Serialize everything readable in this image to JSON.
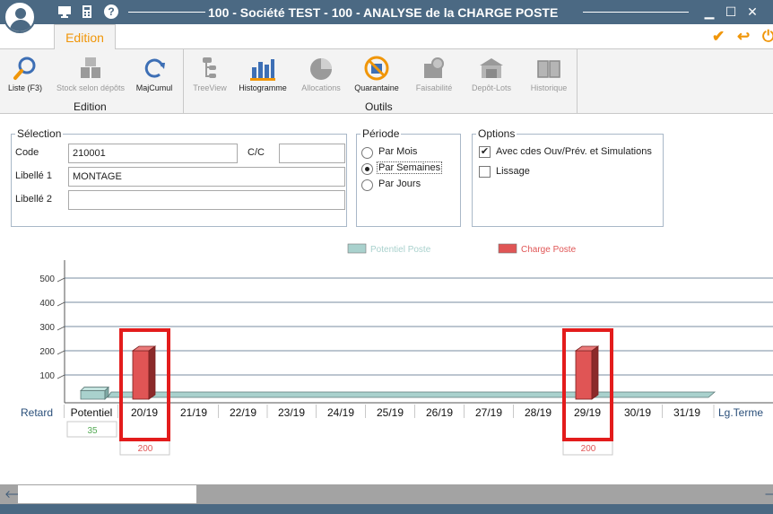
{
  "window": {
    "title": "100 - Société TEST - 100 - ANALYSE de la CHARGE POSTE",
    "help_label": "?",
    "minimize_glyph": "▁",
    "maximize_glyph": "☐",
    "close_glyph": "✕"
  },
  "ribbon": {
    "tab_label": "Edition",
    "actions": {
      "validate_glyph": "✔",
      "back_glyph": "↩",
      "power_glyph": "⏻"
    },
    "edition_group": {
      "label": "Edition",
      "buttons": [
        {
          "label": "Liste (F3)",
          "icon": "search-icon",
          "enabled": true
        },
        {
          "label": "Stock selon dépôts",
          "icon": "boxes-icon",
          "enabled": false
        },
        {
          "label": "MajCumul",
          "icon": "refresh-icon",
          "enabled": true
        }
      ]
    },
    "outils_group": {
      "label": "Outils",
      "buttons": [
        {
          "label": "TreeView",
          "icon": "treeview-icon",
          "enabled": false
        },
        {
          "label": "Histogramme",
          "icon": "histogram-icon",
          "enabled": true
        },
        {
          "label": "Allocations",
          "icon": "pie-chart-icon",
          "enabled": false
        },
        {
          "label": "Quarantaine",
          "icon": "quarantine-icon",
          "enabled": true
        },
        {
          "label": "Faisabilité",
          "icon": "feasibility-icon",
          "enabled": false
        },
        {
          "label": "Depôt-Lots",
          "icon": "warehouse-icon",
          "enabled": false
        },
        {
          "label": "Historique",
          "icon": "book-icon",
          "enabled": false
        }
      ]
    }
  },
  "selection": {
    "legend": "Sélection",
    "code_label": "Code",
    "code_value": "210001",
    "cc_label": "C/C",
    "cc_value": "",
    "libelle1_label": "Libellé 1",
    "libelle1_value": "MONTAGE",
    "libelle2_label": "Libellé 2",
    "libelle2_value": ""
  },
  "periode": {
    "legend": "Période",
    "options": [
      "Par Mois",
      "Par Semaines",
      "Par Jours"
    ],
    "selected": "Par Semaines"
  },
  "options": {
    "legend": "Options",
    "items": [
      {
        "label": "Avec cdes Ouv/Prév. et Simulations",
        "checked": true,
        "check_glyph": "✔"
      },
      {
        "label": "Lissage",
        "checked": false,
        "check_glyph": ""
      }
    ]
  },
  "chart_data": {
    "type": "bar",
    "legend": [
      {
        "name": "Potentiel Poste",
        "color": "#a9d1cd"
      },
      {
        "name": "Charge Poste",
        "color": "#e05555"
      }
    ],
    "legend_placement": "top-center",
    "ylim": [
      0,
      550
    ],
    "yticks": [
      100,
      200,
      300,
      400,
      500
    ],
    "grid": true,
    "categories": [
      "Retard",
      "Potentiel",
      "20/19",
      "21/19",
      "22/19",
      "23/19",
      "24/19",
      "25/19",
      "26/19",
      "27/19",
      "28/19",
      "29/19",
      "30/19",
      "31/19",
      "Lg.Terme"
    ],
    "series": [
      {
        "name": "Potentiel Poste",
        "values": [
          0,
          35,
          35,
          35,
          35,
          35,
          35,
          35,
          35,
          35,
          35,
          35,
          35,
          35,
          0
        ]
      },
      {
        "name": "Charge Poste",
        "values": [
          0,
          0,
          200,
          0,
          0,
          0,
          0,
          0,
          0,
          0,
          0,
          200,
          0,
          0,
          0
        ]
      }
    ],
    "value_labels": [
      {
        "category": "Potentiel",
        "text": "35",
        "color": "#55aa55"
      },
      {
        "category": "20/19",
        "text": "200",
        "color": "#e05555"
      },
      {
        "category": "29/19",
        "text": "200",
        "color": "#e05555"
      }
    ],
    "highlighted_categories": [
      "20/19",
      "29/19"
    ]
  },
  "scrollbar": {
    "left_glyph": "🡐",
    "right_glyph": "🡒"
  }
}
